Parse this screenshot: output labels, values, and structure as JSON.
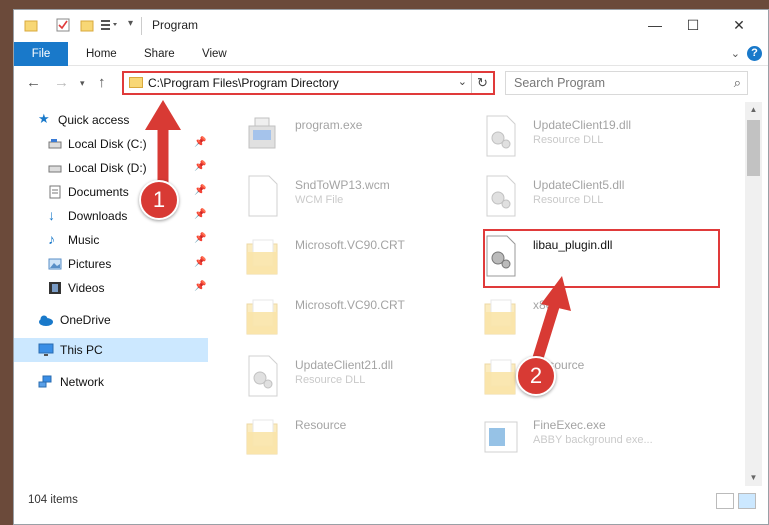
{
  "window": {
    "title": "Program"
  },
  "ribbon": {
    "tabs": [
      "File",
      "Home",
      "Share",
      "View"
    ]
  },
  "address": {
    "path": "C:\\Program Files\\Program Directory"
  },
  "search": {
    "placeholder": "Search Program"
  },
  "sidebar": {
    "items": [
      {
        "label": "Quick access",
        "icon": "star-icon",
        "pinned": false
      },
      {
        "label": "Local Disk (C:)",
        "icon": "drive-icon",
        "pinned": true
      },
      {
        "label": "Local Disk (D:)",
        "icon": "drive-icon",
        "pinned": true
      },
      {
        "label": "Documents",
        "icon": "documents-icon",
        "pinned": true
      },
      {
        "label": "Downloads",
        "icon": "download-arrow-icon",
        "pinned": true
      },
      {
        "label": "Music",
        "icon": "music-note-icon",
        "pinned": true
      },
      {
        "label": "Pictures",
        "icon": "pictures-icon",
        "pinned": true
      },
      {
        "label": "Videos",
        "icon": "film-icon",
        "pinned": true
      },
      {
        "label": "OneDrive",
        "icon": "cloud-icon",
        "pinned": false
      },
      {
        "label": "This PC",
        "icon": "monitor-icon",
        "pinned": false,
        "selected": true
      },
      {
        "label": "Network",
        "icon": "network-icon",
        "pinned": false
      }
    ]
  },
  "files": [
    {
      "name": "program.exe",
      "type": "",
      "icon": "exe-icon"
    },
    {
      "name": "UpdateClient19.dll",
      "type": "Resource DLL",
      "icon": "dll-gear-icon"
    },
    {
      "name": "SndToWP13.wcm",
      "type": "WCM File",
      "icon": "blank-file-icon"
    },
    {
      "name": "UpdateClient5.dll",
      "type": "Resource DLL",
      "icon": "dll-gear-icon"
    },
    {
      "name": "Microsoft.VC90.CRT",
      "type": "",
      "icon": "folder-icon"
    },
    {
      "name": "libau_plugin.dll",
      "type": "",
      "icon": "dll-gear-icon",
      "highlighted": true
    },
    {
      "name": "Microsoft.VC90.CRT",
      "type": "",
      "icon": "folder-icon"
    },
    {
      "name": "x86",
      "type": "",
      "icon": "folder-icon"
    },
    {
      "name": "UpdateClient21.dll",
      "type": "Resource DLL",
      "icon": "dll-gear-icon"
    },
    {
      "name": "Resource",
      "type": "",
      "icon": "folder-icon"
    },
    {
      "name": "Resource",
      "type": "",
      "icon": "folder-icon"
    },
    {
      "name": "FineExec.exe",
      "type": "ABBY background exe...",
      "icon": "exe-window-icon"
    }
  ],
  "status": {
    "item_count": "104 items"
  },
  "annotations": {
    "badge1": "1",
    "badge2": "2"
  },
  "colors": {
    "accent": "#1979ca",
    "annotation_red": "#e03a3a",
    "selected_bg": "#cce8ff",
    "folder_yellow": "#f8d775"
  }
}
